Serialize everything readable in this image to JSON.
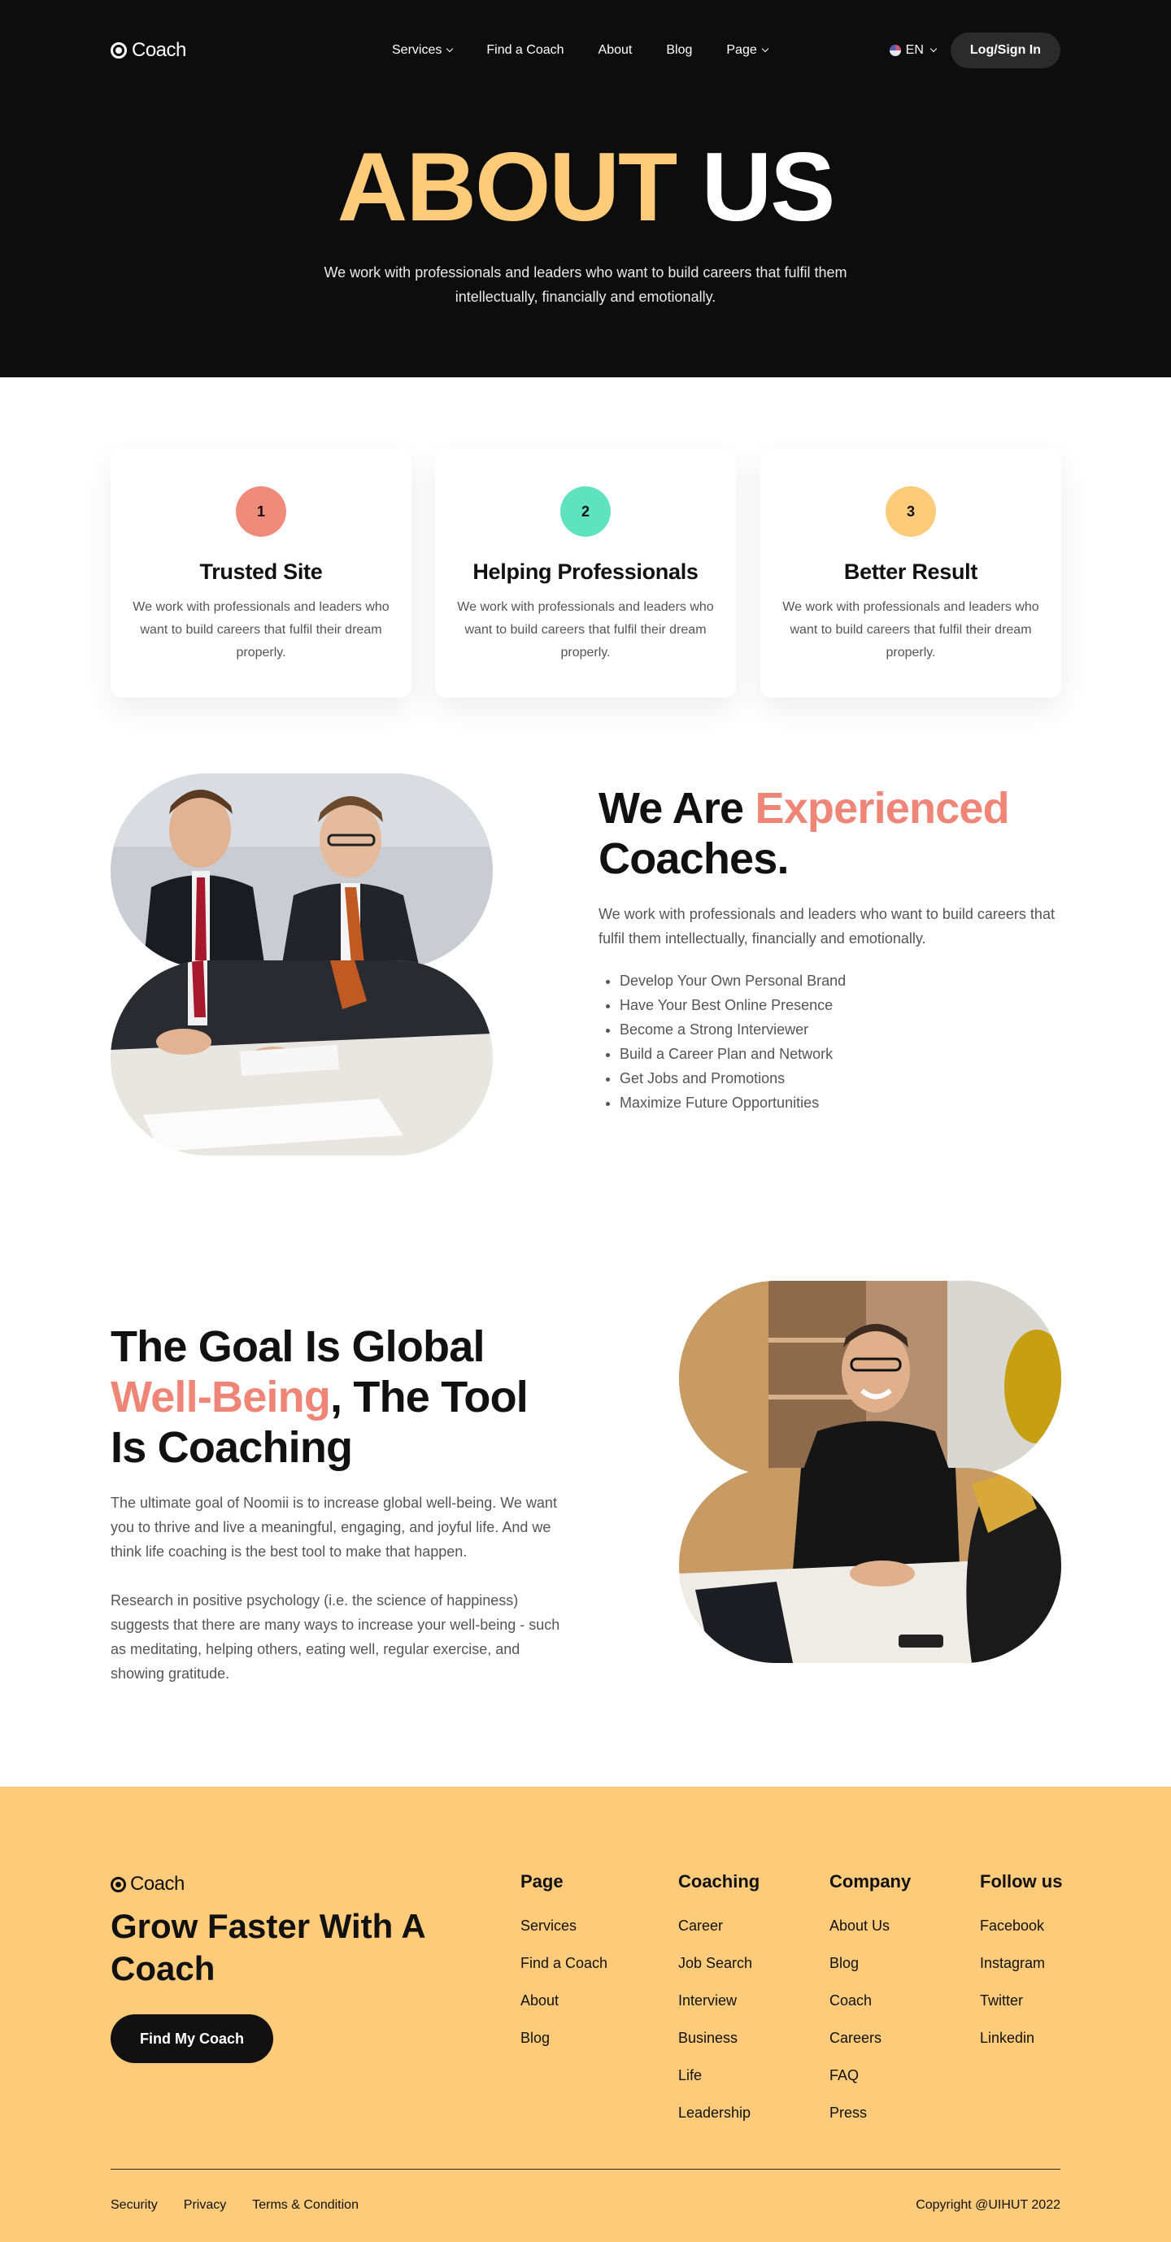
{
  "brand": {
    "name": "Coach"
  },
  "nav": {
    "items": [
      {
        "label": "Services",
        "has_dropdown": true
      },
      {
        "label": "Find a Coach",
        "has_dropdown": false
      },
      {
        "label": "About",
        "has_dropdown": false
      },
      {
        "label": "Blog",
        "has_dropdown": false
      },
      {
        "label": "Page",
        "has_dropdown": true
      }
    ],
    "language": "EN",
    "login_label": "Log/Sign In"
  },
  "hero": {
    "title_highlight": "ABOUT",
    "title_rest": "US",
    "subtitle": "We work with professionals and leaders who want to build careers that fulfil them intellectually, financially and emotionally."
  },
  "features": [
    {
      "number": "1",
      "title": "Trusted Site",
      "text": "We work with professionals and leaders who want to build careers that fulfil their dream properly.",
      "color": "#f08a7a"
    },
    {
      "number": "2",
      "title": "Helping Professionals",
      "text": "We work with professionals and leaders who want to build careers that fulfil their dream properly.",
      "color": "#5fe3bf"
    },
    {
      "number": "3",
      "title": "Better Result",
      "text": "We work with professionals and leaders who want to build careers that fulfil their dream properly.",
      "color": "#fdcb7a"
    }
  ],
  "experienced": {
    "heading_prefix": "We Are ",
    "heading_accent": "Experienced",
    "heading_suffix": "Coaches.",
    "paragraph": "We work with professionals and leaders who want to build careers that fulfil them intellectually, financially and emotionally.",
    "list": [
      "Develop Your Own Personal Brand",
      "Have Your Best Online Presence",
      "Become a Strong Interviewer",
      "Build a Career Plan and Network",
      "Get Jobs and Promotions",
      "Maximize Future Opportunities"
    ]
  },
  "goal": {
    "heading_prefix": "The Goal Is Global",
    "heading_accent": "Well-Being",
    "heading_suffix": ", The Tool Is Coaching",
    "paragraph1": "The ultimate goal of Noomii is to increase global well-being. We want you to thrive and live a meaningful, engaging, and joyful life. And we think life coaching is the best tool to make that happen.",
    "paragraph2": "Research in positive psychology (i.e. the science of happiness) suggests that there are many ways to increase your well-being - such as meditating, helping others, eating well, regular exercise, and showing gratitude."
  },
  "footer": {
    "brand": "Coach",
    "tagline": "Grow Faster With A Coach",
    "cta_label": "Find My Coach",
    "columns": [
      {
        "title": "Page",
        "links": [
          "Services",
          "Find a Coach",
          "About",
          "Blog"
        ]
      },
      {
        "title": "Coaching",
        "links": [
          "Career",
          "Job Search",
          "Interview",
          "Business",
          "Life",
          "Leadership"
        ]
      },
      {
        "title": "Company",
        "links": [
          "About Us",
          "Blog",
          "Coach",
          "Careers",
          "FAQ",
          "Press"
        ]
      },
      {
        "title": "Follow us",
        "links": [
          "Facebook",
          "Instagram",
          "Twitter",
          "Linkedin"
        ]
      }
    ],
    "legal": [
      "Security",
      "Privacy",
      "Terms & Condition"
    ],
    "copyright": "Copyright @UIHUT 2022"
  },
  "colors": {
    "hero_bg": "#0d0d0d",
    "accent_yellow": "#fdcb7a",
    "accent_coral": "#ef8576",
    "accent_mint": "#5fe3bf",
    "footer_bg": "#fdcb7a"
  }
}
